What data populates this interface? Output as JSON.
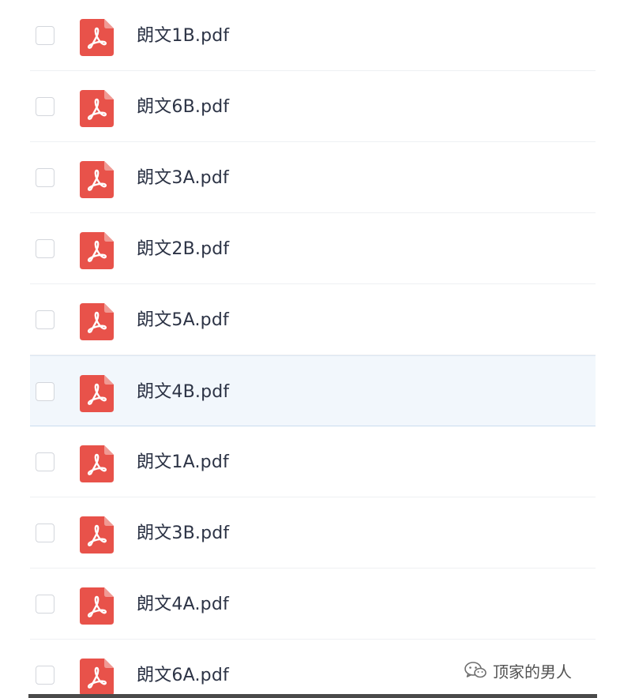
{
  "file_list": {
    "items": [
      {
        "name": "朗文1B.pdf",
        "icon": "pdf-file-icon",
        "selected": false,
        "highlighted": false
      },
      {
        "name": "朗文6B.pdf",
        "icon": "pdf-file-icon",
        "selected": false,
        "highlighted": false
      },
      {
        "name": "朗文3A.pdf",
        "icon": "pdf-file-icon",
        "selected": false,
        "highlighted": false
      },
      {
        "name": "朗文2B.pdf",
        "icon": "pdf-file-icon",
        "selected": false,
        "highlighted": false
      },
      {
        "name": "朗文5A.pdf",
        "icon": "pdf-file-icon",
        "selected": false,
        "highlighted": false
      },
      {
        "name": "朗文4B.pdf",
        "icon": "pdf-file-icon",
        "selected": false,
        "highlighted": true
      },
      {
        "name": "朗文1A.pdf",
        "icon": "pdf-file-icon",
        "selected": false,
        "highlighted": false
      },
      {
        "name": "朗文3B.pdf",
        "icon": "pdf-file-icon",
        "selected": false,
        "highlighted": false
      },
      {
        "name": "朗文4A.pdf",
        "icon": "pdf-file-icon",
        "selected": false,
        "highlighted": false
      },
      {
        "name": "朗文6A.pdf",
        "icon": "pdf-file-icon",
        "selected": false,
        "highlighted": false
      }
    ]
  },
  "watermark": {
    "icon": "wechat-icon",
    "text": "顶家的男人"
  },
  "colors": {
    "pdf_red": "#e8524a",
    "highlight_bg": "#f2f7fc",
    "text": "#2c3345",
    "checkbox_border": "#d3d6dc"
  }
}
